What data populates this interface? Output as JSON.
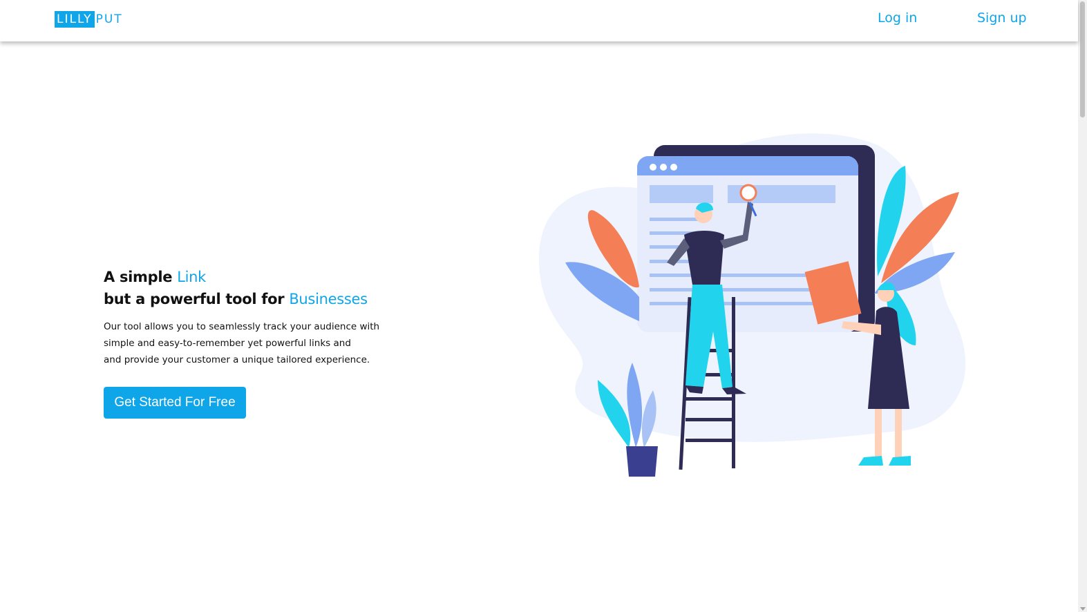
{
  "brand": {
    "logo_box_text": "LILLY",
    "logo_rest_text": "PUT",
    "accent_color": "#0ea5e9"
  },
  "nav": {
    "login_label": "Log in",
    "signup_label": "Sign up"
  },
  "hero": {
    "line1_prefix": "A simple ",
    "line1_accent": "Link",
    "line2_prefix": "but a powerful tool for ",
    "line2_accent": "Businesses",
    "description_lines": [
      "Our tool allows you to seamlessly track your audience with",
      "simple and easy-to-remember yet powerful links and",
      "and provide your customer a unique tailored experience."
    ],
    "cta_label": "Get Started For Free"
  },
  "illustration": {
    "icon": "team-browser-illustration"
  }
}
